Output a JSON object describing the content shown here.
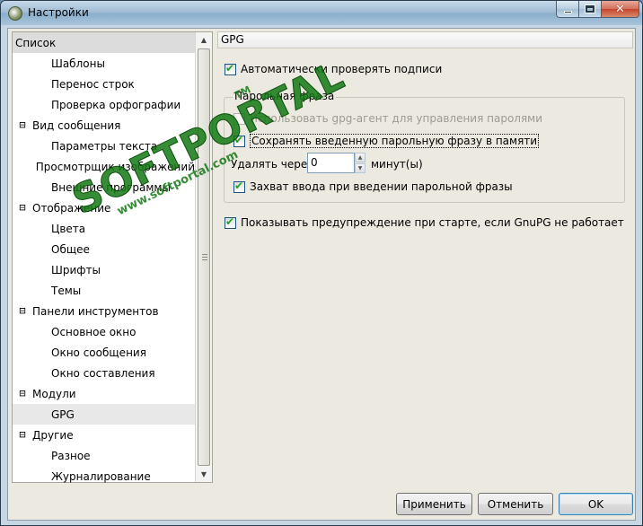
{
  "window": {
    "title": "Настройки"
  },
  "tree": {
    "items": [
      {
        "label": "Список",
        "level": 0,
        "expander": ""
      },
      {
        "label": "Шаблоны",
        "level": 1
      },
      {
        "label": "Перенос строк",
        "level": 1
      },
      {
        "label": "Проверка орфографии",
        "level": 1
      },
      {
        "label": "Вид сообщения",
        "level": 0,
        "expander": "⊟"
      },
      {
        "label": "Параметры текста",
        "level": 1
      },
      {
        "label": "Просмотрщик изображений",
        "level": 1
      },
      {
        "label": "Внешние программы",
        "level": 1
      },
      {
        "label": "Отображение",
        "level": 0,
        "expander": "⊟"
      },
      {
        "label": "Цвета",
        "level": 1
      },
      {
        "label": "Общее",
        "level": 1
      },
      {
        "label": "Шрифты",
        "level": 1
      },
      {
        "label": "Темы",
        "level": 1
      },
      {
        "label": "Панели инструментов",
        "level": 0,
        "expander": "⊟"
      },
      {
        "label": "Основное окно",
        "level": 1
      },
      {
        "label": "Окно сообщения",
        "level": 1
      },
      {
        "label": "Окно составления",
        "level": 1
      },
      {
        "label": "Модули",
        "level": 0,
        "expander": "⊟"
      },
      {
        "label": "GPG",
        "level": 1,
        "selected": true
      },
      {
        "label": "Другие",
        "level": 0,
        "expander": "⊟"
      },
      {
        "label": "Разное",
        "level": 1
      },
      {
        "label": "Журналирование",
        "level": 1
      }
    ]
  },
  "panel": {
    "title": "GPG",
    "auto_check": {
      "label": "Автоматически проверять подписи",
      "checked": true
    },
    "passphrase_group": {
      "legend": "Парольная фраза",
      "use_agent": {
        "label": "Использовать gpg-агент для управления паролями",
        "checked": false,
        "disabled": true
      },
      "store_passphrase": {
        "label": "Сохранять введенную парольную фразу в памяти",
        "checked": true
      },
      "expire_label": "Удалять через",
      "expire_value": "0",
      "expire_unit": "минут(ы)",
      "grab_input": {
        "label": "Захват ввода при введении парольной фразы",
        "checked": true
      }
    },
    "warn_gnupg": {
      "label": "Показывать предупреждение при старте, если GnuPG не работает",
      "checked": true
    }
  },
  "buttons": {
    "apply": "Применить",
    "cancel": "Отменить",
    "ok": "OK"
  },
  "watermark": {
    "main": "SOFTPORTAL",
    "sub": "www.softportal.com",
    "tm": "TM"
  }
}
